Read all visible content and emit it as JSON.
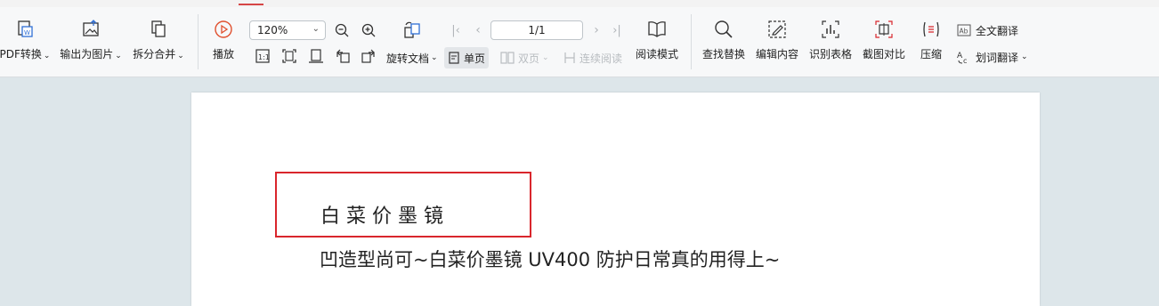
{
  "toolbar": {
    "pdf_convert": "PDF转换",
    "export_image": "输出为图片",
    "split_merge": "拆分合并",
    "play": "播放",
    "zoom_value": "120%",
    "page_indicator": "1/1",
    "rotate_doc": "旋转文档",
    "single_page": "单页",
    "double_page": "双页",
    "continuous_read": "连续阅读",
    "reading_mode": "阅读模式",
    "find_replace": "查找替换",
    "edit_content": "编辑内容",
    "recognize_table": "识别表格",
    "screenshot_compare": "截图对比",
    "compress": "压缩",
    "full_translate": "全文翻译",
    "word_translate": "划词翻译"
  },
  "document": {
    "title": "白菜价墨镜",
    "body": "凹造型尚可~白菜价墨镜 UV400 防护日常真的用得上~"
  },
  "colors": {
    "highlight_box": "#d9262c",
    "play_icon": "#e0502e"
  }
}
